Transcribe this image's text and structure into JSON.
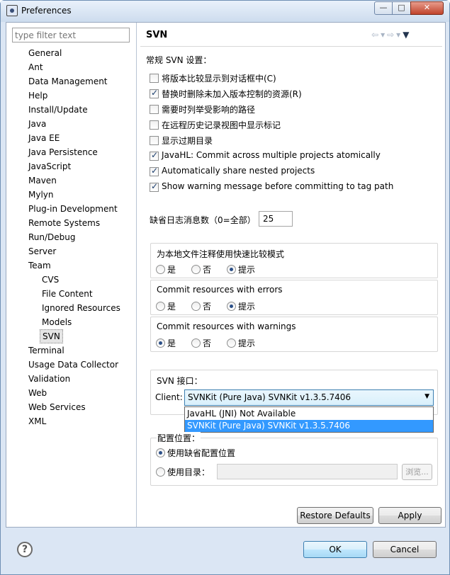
{
  "window": {
    "title": "Preferences",
    "min": "—",
    "max": "□",
    "close": "✕"
  },
  "filter": {
    "placeholder": "type filter text"
  },
  "tree": [
    "General",
    "Ant",
    "Data Management",
    "Help",
    "Install/Update",
    "Java",
    "Java EE",
    "Java Persistence",
    "JavaScript",
    "Maven",
    "Mylyn",
    "Plug-in Development",
    "Remote Systems",
    "Run/Debug",
    "Server",
    "Team",
    "CVS",
    "File Content",
    "Ignored Resources",
    "Models",
    "SVN",
    "Terminal",
    "Usage Data Collector",
    "Validation",
    "Web",
    "Web Services",
    "XML"
  ],
  "page": {
    "title": "SVN",
    "section": "常规 SVN 设置：",
    "checkboxes": [
      {
        "label": "将版本比较显示到对话框中(C)",
        "checked": false
      },
      {
        "label": "替换时删除未加入版本控制的资源(R)",
        "checked": true
      },
      {
        "label": "需要时列举受影响的路径",
        "checked": false
      },
      {
        "label": "在远程历史记录视图中显示标记",
        "checked": false
      },
      {
        "label": "显示过期目录",
        "checked": false
      },
      {
        "label": "JavaHL: Commit across multiple projects atomically",
        "checked": true
      },
      {
        "label": "Automatically share nested projects",
        "checked": true
      },
      {
        "label": "Show warning message before committing to tag path",
        "checked": true
      }
    ],
    "log_label": "缺省日志消息数（0=全部）",
    "log_value": "25",
    "groups": [
      {
        "title": "为本地文件注释使用快速比较模式",
        "options": [
          "是",
          "否",
          "提示"
        ],
        "selected": 2
      },
      {
        "title": "Commit resources with errors",
        "options": [
          "是",
          "否",
          "提示"
        ],
        "selected": 2
      },
      {
        "title": "Commit resources with warnings",
        "options": [
          "是",
          "否",
          "提示"
        ],
        "selected": 0
      }
    ],
    "svn_interface": {
      "title": "SVN 接口：",
      "client_label": "Client:",
      "client_value": "SVNKit (Pure Java) SVNKit v1.3.5.7406",
      "options": [
        "JavaHL (JNI) Not Available",
        "SVNKit (Pure Java) SVNKit v1.3.5.7406"
      ]
    },
    "config": {
      "title": "配置位置：",
      "opt_default": "使用缺省配置位置",
      "opt_dir": "使用目录：",
      "browse": "浏览..."
    },
    "restore": "Restore Defaults",
    "apply": "Apply"
  },
  "footer": {
    "ok": "OK",
    "cancel": "Cancel",
    "help": "?"
  }
}
